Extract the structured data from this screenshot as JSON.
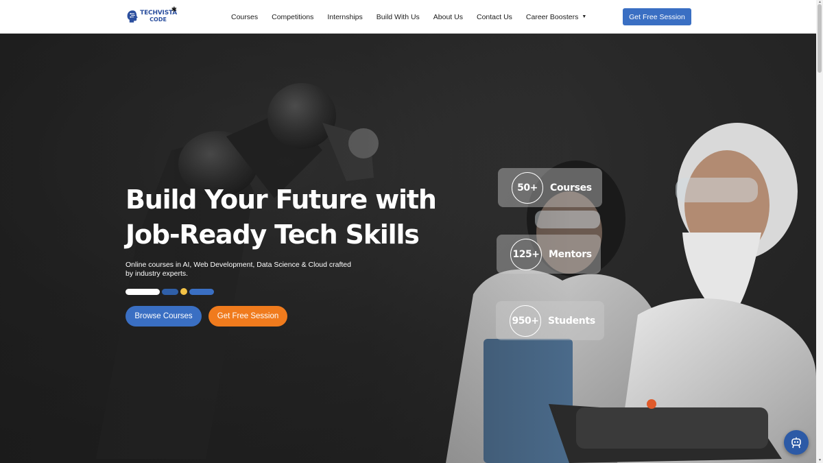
{
  "brand": {
    "name_line1": "TECHVISTA",
    "name_line2": "CODE",
    "primary_color": "#3a6fc3",
    "accent_color": "#f07b1d"
  },
  "nav": {
    "links": [
      "Courses",
      "Competitions",
      "Internships",
      "Build With Us",
      "About Us",
      "Contact Us",
      "Career Boosters"
    ],
    "cta": "Get Free Session"
  },
  "hero": {
    "headline_line1": "Build Your Future with",
    "headline_line2": "Job-Ready Tech Skills",
    "subtext": "Online courses in AI, Web Development, Data Science & Cloud crafted by industry experts.",
    "primary_button": "Browse Courses",
    "secondary_button": "Get Free Session",
    "stats": [
      {
        "value": "50+",
        "label": "Courses"
      },
      {
        "value": "125+",
        "label": "Mentors"
      },
      {
        "value": "950+",
        "label": "Students"
      }
    ]
  },
  "icons": {
    "chat": "robot-chat-icon",
    "dropdown": "caret-down-icon"
  }
}
